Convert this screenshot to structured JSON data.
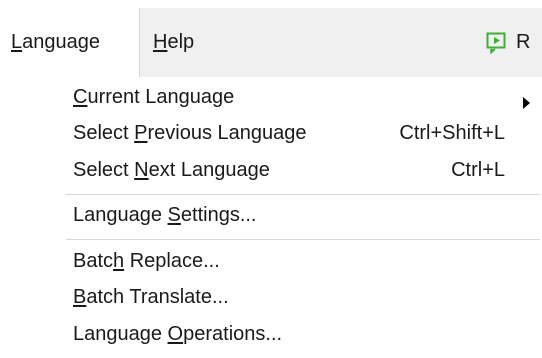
{
  "menubar": {
    "language": {
      "mnemonic": "L",
      "rest": "anguage"
    },
    "help": {
      "mnemonic": "H",
      "rest": "elp"
    },
    "run": {
      "icon": "run-icon",
      "label": "R",
      "color": "#3fae3a"
    }
  },
  "dropdown": {
    "current_language": {
      "pre": "",
      "mnemonic": "C",
      "post": "urrent Language",
      "submenu_icon": "chevron-right-icon"
    },
    "select_previous": {
      "pre": "Select ",
      "mnemonic": "P",
      "post": "revious Language",
      "shortcut": "Ctrl+Shift+L"
    },
    "select_next": {
      "pre": "Select ",
      "mnemonic": "N",
      "post": "ext Language",
      "shortcut": "Ctrl+L"
    },
    "language_settings": {
      "pre": "Language ",
      "mnemonic": "S",
      "post": "ettings..."
    },
    "batch_replace": {
      "pre": "Batc",
      "mnemonic": "h",
      "post": " Replace..."
    },
    "batch_translate": {
      "pre": "",
      "mnemonic": "B",
      "post": "atch Translate..."
    },
    "language_operations": {
      "pre": "Language ",
      "mnemonic": "O",
      "post": "perations..."
    }
  }
}
